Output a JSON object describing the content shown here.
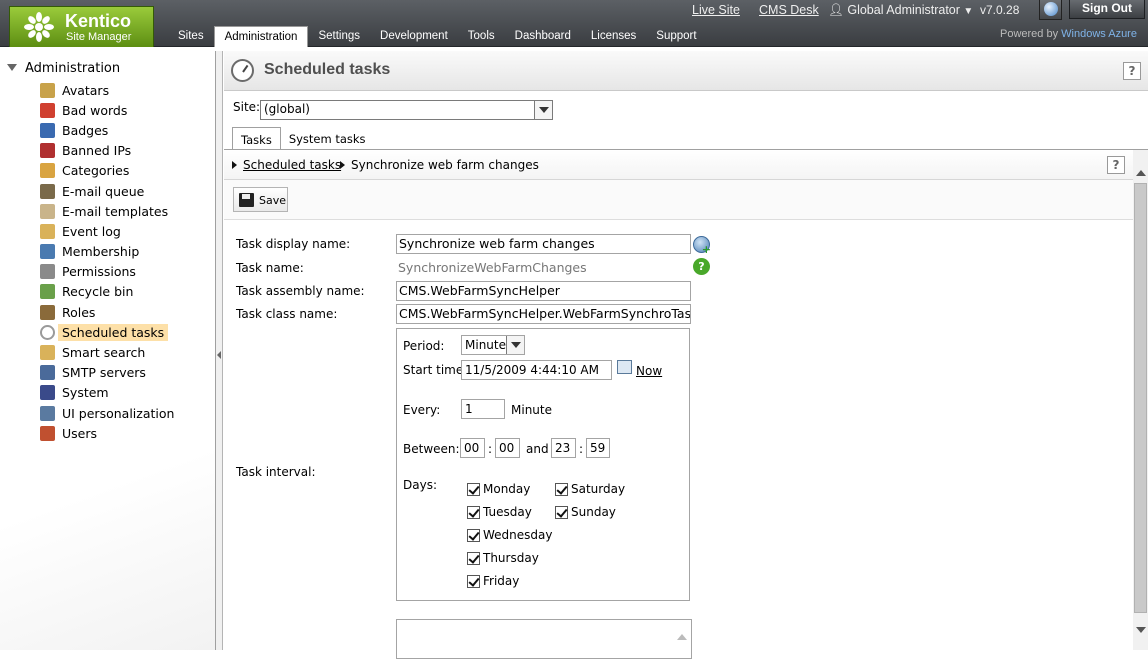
{
  "header": {
    "logo_title": "Kentico",
    "logo_subtitle": "Site Manager",
    "tabs": [
      {
        "label": "Sites",
        "selected": false
      },
      {
        "label": "Administration",
        "selected": true
      },
      {
        "label": "Settings",
        "selected": false
      },
      {
        "label": "Development",
        "selected": false
      },
      {
        "label": "Tools",
        "selected": false
      },
      {
        "label": "Dashboard",
        "selected": false
      },
      {
        "label": "Licenses",
        "selected": false
      },
      {
        "label": "Support",
        "selected": false
      }
    ],
    "live_site": "Live Site",
    "cms_desk": "CMS Desk",
    "user": "Global Administrator",
    "version": "v7.0.28",
    "sign_out": "Sign Out",
    "powered_by": "Powered by",
    "powered_brand": "Windows Azure"
  },
  "sidebar": {
    "root": "Administration",
    "items": [
      {
        "label": "Avatars",
        "icon": "avatar-icon",
        "color": "#c8a24a"
      },
      {
        "label": "Bad words",
        "icon": "bad-words-icon",
        "color": "#d04030"
      },
      {
        "label": "Badges",
        "icon": "badge-icon",
        "color": "#3a6ab0"
      },
      {
        "label": "Banned IPs",
        "icon": "banned-ip-icon",
        "color": "#b03030"
      },
      {
        "label": "Categories",
        "icon": "categories-icon",
        "color": "#d9a441"
      },
      {
        "label": "E-mail queue",
        "icon": "email-queue-icon",
        "color": "#7a6a4a"
      },
      {
        "label": "E-mail templates",
        "icon": "email-template-icon",
        "color": "#c9b48a"
      },
      {
        "label": "Event log",
        "icon": "event-log-icon",
        "color": "#d9b25a"
      },
      {
        "label": "Membership",
        "icon": "membership-icon",
        "color": "#4a7ab0"
      },
      {
        "label": "Permissions",
        "icon": "permissions-icon",
        "color": "#8a8a8a"
      },
      {
        "label": "Recycle bin",
        "icon": "recycle-bin-icon",
        "color": "#6aa04a"
      },
      {
        "label": "Roles",
        "icon": "roles-icon",
        "color": "#8a6a3a"
      },
      {
        "label": "Scheduled tasks",
        "icon": "clock-icon",
        "color": "#9a9a9a",
        "selected": true
      },
      {
        "label": "Smart search",
        "icon": "smart-search-icon",
        "color": "#d9b25a"
      },
      {
        "label": "SMTP servers",
        "icon": "smtp-icon",
        "color": "#4a6a9a"
      },
      {
        "label": "System",
        "icon": "system-icon",
        "color": "#3a4a8a"
      },
      {
        "label": "UI personalization",
        "icon": "ui-personalization-icon",
        "color": "#5a7aa0"
      },
      {
        "label": "Users",
        "icon": "users-icon",
        "color": "#c05030"
      }
    ]
  },
  "page": {
    "title": "Scheduled tasks",
    "help": "?",
    "site_label": "Site:",
    "site_value": "(global)",
    "subtabs": [
      {
        "label": "Tasks",
        "selected": true
      },
      {
        "label": "System tasks",
        "selected": false
      }
    ],
    "breadcrumb": {
      "link": "Scheduled tasks",
      "current": "Synchronize web farm changes"
    },
    "save_label": "Save"
  },
  "form": {
    "display_name_label": "Task display name:",
    "display_name_value": "Synchronize web farm changes",
    "task_name_label": "Task name:",
    "task_name_value": "SynchronizeWebFarmChanges",
    "assembly_label": "Task assembly name:",
    "assembly_value": "CMS.WebFarmSyncHelper",
    "class_label": "Task class name:",
    "class_value": "CMS.WebFarmSyncHelper.WebFarmSynchroTas",
    "interval_label": "Task interval:",
    "interval": {
      "period_label": "Period:",
      "period_value": "Minute",
      "start_label": "Start time:",
      "start_value": "11/5/2009 4:44:10 AM",
      "now_label": "Now",
      "every_label": "Every:",
      "every_value": "1",
      "every_unit": "Minute",
      "between_label": "Between:",
      "from_h": "00",
      "from_m": "00",
      "and_label": "and",
      "to_h": "23",
      "to_m": "59",
      "colon": ":",
      "days_label": "Days:",
      "days": [
        {
          "label": "Monday",
          "checked": true
        },
        {
          "label": "Tuesday",
          "checked": true
        },
        {
          "label": "Wednesday",
          "checked": true
        },
        {
          "label": "Thursday",
          "checked": true
        },
        {
          "label": "Friday",
          "checked": true
        },
        {
          "label": "Saturday",
          "checked": true
        },
        {
          "label": "Sunday",
          "checked": true
        }
      ]
    }
  }
}
